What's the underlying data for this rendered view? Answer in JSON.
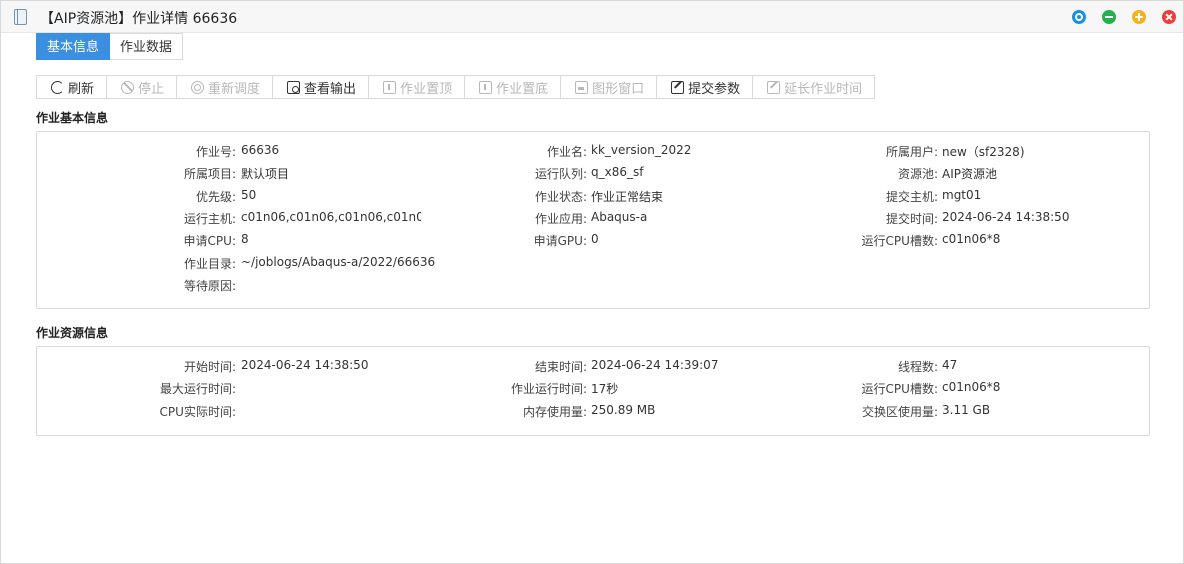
{
  "window": {
    "title": "【AIP资源池】作业详情 66636",
    "icon": "document-icon",
    "controls": [
      "restore",
      "minimize",
      "maximize",
      "close"
    ]
  },
  "tabs": [
    {
      "label": "基本信息",
      "active": true
    },
    {
      "label": "作业数据",
      "active": false
    }
  ],
  "toolbar": [
    {
      "label": "刷新",
      "icon": "refresh-icon",
      "enabled": true
    },
    {
      "label": "停止",
      "icon": "stop-icon",
      "enabled": false
    },
    {
      "label": "重新调度",
      "icon": "reschedule-icon",
      "enabled": false
    },
    {
      "label": "查看输出",
      "icon": "output-icon",
      "enabled": true
    },
    {
      "label": "作业置顶",
      "icon": "pin-top-icon",
      "enabled": false
    },
    {
      "label": "作业置底",
      "icon": "pin-bottom-icon",
      "enabled": false
    },
    {
      "label": "图形窗口",
      "icon": "window-icon",
      "enabled": false
    },
    {
      "label": "提交参数",
      "icon": "edit-icon",
      "enabled": true
    },
    {
      "label": "延长作业时间",
      "icon": "edit-icon",
      "enabled": false
    }
  ],
  "basic_info": {
    "title": "作业基本信息",
    "rows": [
      [
        {
          "label": "作业号:",
          "value": "66636"
        },
        {
          "label": "作业名:",
          "value": "kk_version_2022"
        },
        {
          "label": "所属用户:",
          "value": "new（sf2328)"
        }
      ],
      [
        {
          "label": "所属项目:",
          "value": "默认项目"
        },
        {
          "label": "运行队列:",
          "value": "q_x86_sf"
        },
        {
          "label": "资源池:",
          "value": "AIP资源池"
        }
      ],
      [
        {
          "label": "优先级:",
          "value": "50"
        },
        {
          "label": "作业状态:",
          "value": "作业正常结束"
        },
        {
          "label": "提交主机:",
          "value": "mgt01"
        }
      ],
      [
        {
          "label": "运行主机:",
          "value": "c01n06,c01n06,c01n06,c01n0..."
        },
        {
          "label": "作业应用:",
          "value": "Abaqus-a"
        },
        {
          "label": "提交时间:",
          "value": "2024-06-24 14:38:50"
        }
      ],
      [
        {
          "label": "申请CPU:",
          "value": "8"
        },
        {
          "label": "申请GPU:",
          "value": "0"
        },
        {
          "label": "运行CPU槽数:",
          "value": "c01n06*8"
        }
      ],
      [
        {
          "label": "作业目录:",
          "value": "~/joblogs/Abaqus-a/2022/66636"
        }
      ],
      [
        {
          "label": "等待原因:",
          "value": ""
        }
      ]
    ]
  },
  "resource_info": {
    "title": "作业资源信息",
    "rows": [
      [
        {
          "label": "开始时间:",
          "value": "2024-06-24 14:38:50"
        },
        {
          "label": "结束时间:",
          "value": "2024-06-24 14:39:07"
        },
        {
          "label": "线程数:",
          "value": "47"
        }
      ],
      [
        {
          "label": "最大运行时间:",
          "value": ""
        },
        {
          "label": "作业运行时间:",
          "value": "17秒"
        },
        {
          "label": "运行CPU槽数:",
          "value": "c01n06*8"
        }
      ],
      [
        {
          "label": "CPU实际时间:",
          "value": ""
        },
        {
          "label": "内存使用量:",
          "value": "250.89 MB"
        },
        {
          "label": "交换区使用量:",
          "value": "3.11 GB"
        }
      ]
    ]
  },
  "colors": {
    "active_tab": "#3b8fe0",
    "restore": "#1a8fe3",
    "minimize": "#22b14c",
    "maximize": "#f5b21d",
    "close": "#ec3d3d"
  }
}
